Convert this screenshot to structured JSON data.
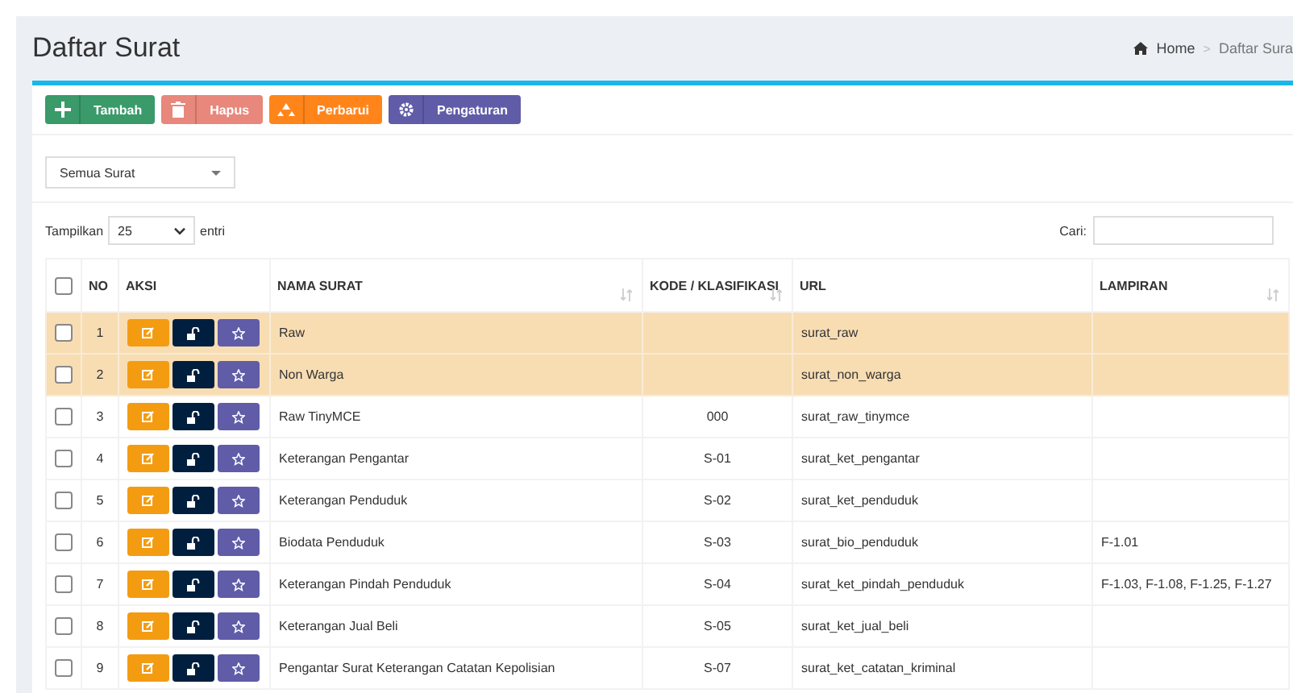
{
  "page": {
    "title": "Daftar Surat"
  },
  "breadcrumb": {
    "separator": ">",
    "items": [
      {
        "label": "Home",
        "kind": "home"
      },
      {
        "label": "Daftar Sura",
        "kind": "text"
      }
    ]
  },
  "toolbar": [
    {
      "label": "Tambah",
      "kind": "add",
      "color": "#3a9a6a"
    },
    {
      "label": "Hapus",
      "kind": "delete",
      "color": "#e8877c"
    },
    {
      "label": "Perbarui",
      "kind": "refresh",
      "color": "#ff851b"
    },
    {
      "label": "Pengaturan",
      "kind": "settings",
      "color": "#605ca8"
    }
  ],
  "filter": {
    "value": "Semua Surat"
  },
  "length_control": {
    "prefix": "Tampilkan",
    "value": "25",
    "suffix": "entri"
  },
  "search": {
    "label": "Cari:"
  },
  "table": {
    "select_all_checked": false,
    "columns": [
      {
        "label": "NO",
        "sortable": false
      },
      {
        "label": "AKSI",
        "sortable": false
      },
      {
        "label": "NAMA SURAT",
        "sortable": true
      },
      {
        "label": "KODE / KLASIFIKASI",
        "sortable": true
      },
      {
        "label": "URL",
        "sortable": false
      },
      {
        "label": "LAMPIRAN",
        "sortable": true
      }
    ],
    "rows": [
      {
        "no": "1",
        "name": "Raw",
        "code": "",
        "url": "surat_raw",
        "attachment": "",
        "highlighted": true,
        "checked": false
      },
      {
        "no": "2",
        "name": "Non Warga",
        "code": "",
        "url": "surat_non_warga",
        "attachment": "",
        "highlighted": true,
        "checked": false
      },
      {
        "no": "3",
        "name": "Raw TinyMCE",
        "code": "000",
        "url": "surat_raw_tinymce",
        "attachment": "",
        "highlighted": false,
        "checked": false
      },
      {
        "no": "4",
        "name": "Keterangan Pengantar",
        "code": "S-01",
        "url": "surat_ket_pengantar",
        "attachment": "",
        "highlighted": false,
        "checked": false
      },
      {
        "no": "5",
        "name": "Keterangan Penduduk",
        "code": "S-02",
        "url": "surat_ket_penduduk",
        "attachment": "",
        "highlighted": false,
        "checked": false
      },
      {
        "no": "6",
        "name": "Biodata Penduduk",
        "code": "S-03",
        "url": "surat_bio_penduduk",
        "attachment": "F-1.01",
        "highlighted": false,
        "checked": false
      },
      {
        "no": "7",
        "name": "Keterangan Pindah Penduduk",
        "code": "S-04",
        "url": "surat_ket_pindah_penduduk",
        "attachment": "F-1.03, F-1.08, F-1.25, F-1.27",
        "highlighted": false,
        "checked": false
      },
      {
        "no": "8",
        "name": "Keterangan Jual Beli",
        "code": "S-05",
        "url": "surat_ket_jual_beli",
        "attachment": "",
        "highlighted": false,
        "checked": false
      },
      {
        "no": "9",
        "name": "Pengantar Surat Keterangan Catatan Kepolisian",
        "code": "S-07",
        "url": "surat_ket_catatan_kriminal",
        "attachment": "",
        "highlighted": false,
        "checked": false
      }
    ]
  }
}
